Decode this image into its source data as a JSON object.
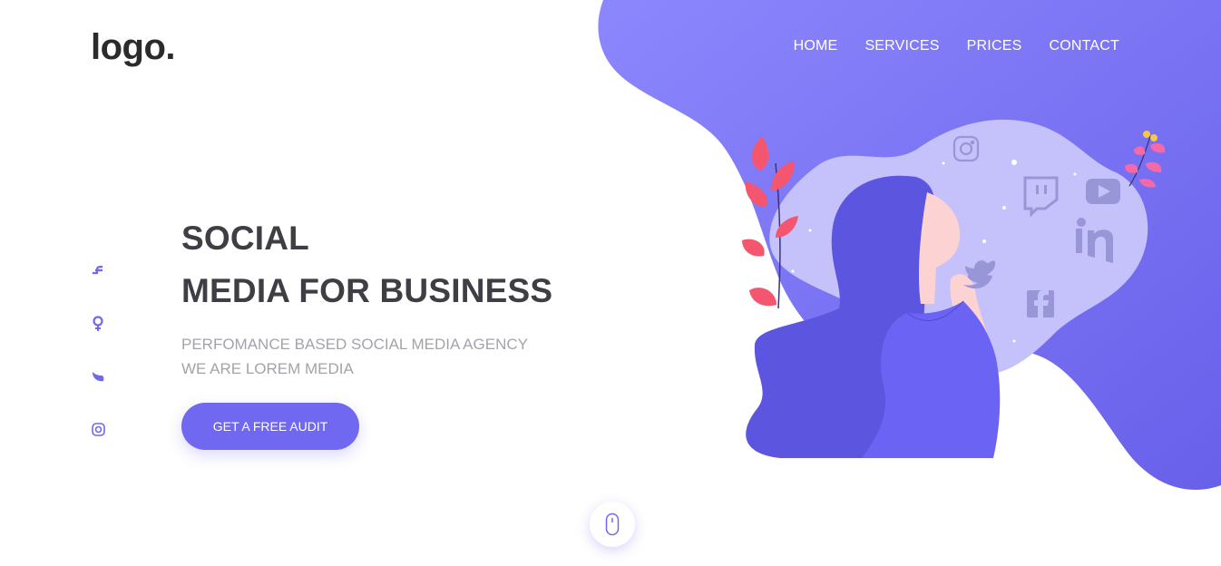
{
  "brand": {
    "logo_text": "logo."
  },
  "nav": {
    "items": [
      {
        "label": "HOME"
      },
      {
        "label": "SERVICES"
      },
      {
        "label": "PRICES"
      },
      {
        "label": "CONTACT"
      }
    ]
  },
  "social_rail": [
    "facebook-icon",
    "google-plus-icon",
    "twitter-icon",
    "instagram-icon"
  ],
  "hero": {
    "title_line1": "SOCIAL",
    "title_line2": "MEDIA FOR BUSINESS",
    "subtitle_line1": "PERFOMANCE BASED SOCIAL MEDIA AGENCY",
    "subtitle_line2": "WE ARE LOREM MEDIA",
    "cta_label": "GET A FREE AUDIT"
  },
  "illustration": {
    "floating_icons": [
      "instagram-icon",
      "twitch-icon",
      "youtube-icon",
      "linkedin-icon",
      "twitter-icon",
      "facebook-icon"
    ]
  },
  "colors": {
    "accent": "#7068f0",
    "blob_light": "#8b85fb",
    "blob_dark": "#6a62ea",
    "inner_blob": "#c4c1fb",
    "hair": "#5b55e0",
    "title": "#3e3e44",
    "subtitle": "#a3a3ab",
    "plant_pink": "#f4566f"
  }
}
